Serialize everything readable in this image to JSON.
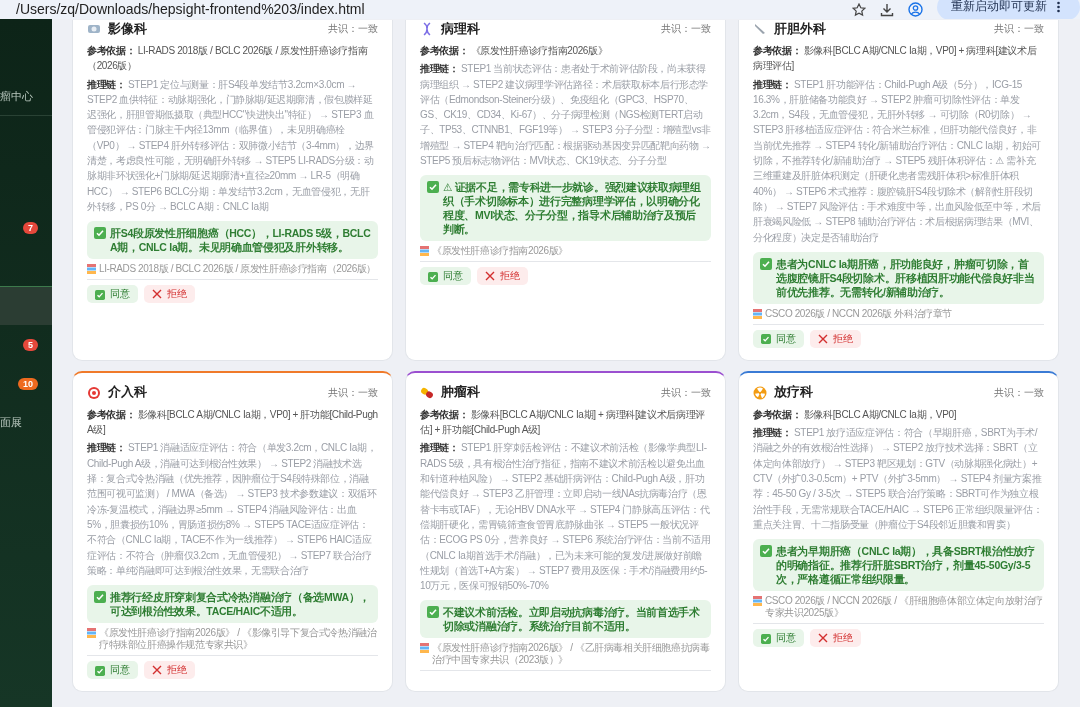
{
  "browser": {
    "url": "/Users/zq/Downloads/hepsight-frontend%203/index.html",
    "update_button": "重新启动即可更新"
  },
  "sidebar": {
    "items": [
      {
        "label": "瘤中心",
        "selected": false
      },
      {
        "badge": "7",
        "color": "#e5483b",
        "selected": false
      },
      {
        "selected": true
      },
      {
        "badge": "5",
        "color": "#e5483b",
        "selected": false
      },
      {
        "badge": "10",
        "color": "#ee6a1f",
        "selected": false
      },
      {
        "label": "面展",
        "selected": false
      }
    ]
  },
  "cards": [
    {
      "kind": "imaging",
      "department": "影像科",
      "consensus": "共识：一致",
      "basis_label": "参考依据：",
      "basis": "LI-RADS 2018版 / BCLC 2026版 / 原发性肝癌诊疗指南（2026版）",
      "chain_label": "推理链：",
      "chain": "STEP1 定位与测量：肝S4段单发结节3.2cm×3.0cm → STEP2 血供特征：动脉期强化，门静脉期/延迟期廓清，假包膜样延迟强化，肝胆管期低摄取（典型HCC\"快进快出\"特征） → STEP3 血管侵犯评估：门脉主干内径13mm（临界值），未见明确癌栓（VP0） → STEP4 肝外转移评估：双肺微小结节（3-4mm），边界清楚，考虑良性可能，无明确肝外转移 → STEP5 LI-RADS分级：动脉期非环状强化+门脉期/延迟期廓清+直径≥20mm → LR-5（明确HCC） → STEP6 BCLC分期：单发结节3.2cm，无血管侵犯，无肝外转移，PS 0分 → BCLC A期：CNLC Ia期",
      "conclusion": "肝S4段原发性肝细胞癌（HCC），LI-RADS 5级，BCLC A期，CNLC Ia期。未见明确血管侵犯及肝外转移。",
      "source": "LI-RADS 2018版 / BCLC 2026版 / 原发性肝癌诊疗指南（2026版）",
      "buttons": [
        {
          "kind": "agree",
          "label": "同意"
        },
        {
          "kind": "reject",
          "label": "拒绝"
        }
      ]
    },
    {
      "kind": "pathology",
      "department": "病理科",
      "consensus": "共识：一致",
      "basis_label": "参考依据：",
      "basis": "《原发性肝癌诊疗指南2026版》",
      "chain_label": "推理链：",
      "chain": "STEP1 当前状态评估：患者处于术前评估阶段，尚未获得病理组织 → STEP2 建议病理学评估路径：术后获取标本后行形态学评估（Edmondson-Steiner分级）、免疫组化（GPC3、HSP70、GS、CK19、CD34、Ki-67）、分子病理检测（NGS检测TERT启动子、TP53、CTNNB1、FGF19等） → STEP3 分子分型：增殖型vs非增殖型 → STEP4 靶向治疗匹配：根据驱动基因变异匹配靶向药物 → STEP5 预后标志物评估：MVI状态、CK19状态、分子分型",
      "conclusion": "⚠ 证据不足，需专科进一步就诊。强烈建议获取病理组织（手术切除标本）进行完整病理学评估，以明确分化程度、MVI状态、分子分型，指导术后辅助治疗及预后判断。",
      "source": "《原发性肝癌诊疗指南2026版》",
      "buttons": [
        {
          "kind": "agree",
          "label": "同意"
        },
        {
          "kind": "reject",
          "label": "拒绝"
        }
      ]
    },
    {
      "kind": "surgery",
      "department": "肝胆外科",
      "consensus": "共识：一致",
      "basis_label": "参考依据：",
      "basis": "影像科[BCLC A期/CNLC Ia期，VP0] + 病理科[建议术后病理评估]",
      "chain_label": "推理链：",
      "chain": "STEP1 肝功能评估：Child-Pugh A级（5分），ICG-15 16.3%，肝脏储备功能良好 → STEP2 肿瘤可切除性评估：单发3.2cm，S4段，无血管侵犯，无肝外转移 → 可切除（R0切除） → STEP3 肝移植适应症评估：符合米兰标准，但肝功能代偿良好，非当前优先推荐 → STEP4 转化/新辅助治疗评估：CNLC Ia期，初始可切除，不推荐转化/新辅助治疗 → STEP5 残肝体积评估：⚠ 需补充三维重建及肝脏体积测定（肝硬化患者需残肝体积>标准肝体积40%） → STEP6 术式推荐：腹腔镜肝S4段切除术（解剖性肝段切除） → STEP7 风险评估：手术难度中等，出血风险低至中等，术后肝衰竭风险低 → STEP8 辅助治疗评估：术后根据病理结果（MVI、分化程度）决定是否辅助治疗",
      "conclusion": "患者为CNLC Ia期肝癌，肝功能良好，肿瘤可切除，首选腹腔镜肝S4段切除术。肝移植因肝功能代偿良好非当前优先推荐。无需转化/新辅助治疗。",
      "source": "CSCO 2026版 / NCCN 2026版 外科治疗章节",
      "buttons": [
        {
          "kind": "agree",
          "label": "同意"
        },
        {
          "kind": "reject",
          "label": "拒绝"
        }
      ]
    },
    {
      "kind": "interventional",
      "color": "#f07a2a",
      "department": "介入科",
      "consensus": "共识：一致",
      "basis_label": "参考依据：",
      "basis": "影像科[BCLC A期/CNLC Ia期，VP0] + 肝功能[Child-Pugh A级]",
      "chain_label": "推理链：",
      "chain": "STEP1 消融适应症评估：符合（单发3.2cm，CNLC Ia期，Child-Pugh A级，消融可达到根治性效果） → STEP2 消融技术选择：复合式冷热消融（优先推荐，因肿瘤位于S4段特殊部位，消融范围可视可监测） / MWA（备选） → STEP3 技术参数建议：双循环冷冻-复温模式，消融边界≥5mm → STEP4 消融风险评估：出血5%，胆囊损伤10%，胃肠道损伤8% → STEP5 TACE适应症评估：不符合（CNLC Ia期，TACE不作为一线推荐） → STEP6 HAIC适应症评估：不符合（肿瘤仅3.2cm，无血管侵犯） → STEP7 联合治疗策略：单纯消融即可达到根治性效果，无需联合治疗",
      "conclusion": "推荐行经皮肝穿刺复合式冷热消融治疗（备选MWA），可达到根治性效果。TACE/HAIC不适用。",
      "source": "《原发性肝癌诊疗指南2026版》 / 《影像引导下复合式冷热消融治疗特殊部位肝癌操作规范专家共识》",
      "buttons": [
        {
          "kind": "agree",
          "label": "同意"
        },
        {
          "kind": "reject",
          "label": "拒绝"
        }
      ]
    },
    {
      "kind": "oncology",
      "color": "#9b4fd0",
      "department": "肿瘤科",
      "consensus": "共识：一致",
      "basis_label": "参考依据：",
      "basis": "影像科[BCLC A期/CNLC Ia期] + 病理科[建议术后病理评估] + 肝功能[Child-Pugh A级]",
      "chain_label": "推理链：",
      "chain": "STEP1 肝穿刺活检评估：不建议术前活检（影像学典型LI-RADS 5级，具有根治性治疗指征，指南不建议术前活检以避免出血和针道种植风险） → STEP2 基础肝病评估：Child-Pugh A级，肝功能代偿良好 → STEP3 乙肝管理：立即启动一线NAs抗病毒治疗（恩替卡韦或TAF），无论HBV DNA水平 → STEP4 门静脉高压评估：代偿期肝硬化，需胃镜筛查食管胃底静脉曲张 → STEP5 一般状况评估：ECOG PS 0分，营养良好 → STEP6 系统治疗评估：当前不适用（CNLC Ia期首选手术/消融），已为未来可能的复发/进展做好前瞻性规划（首选T+A方案） → STEP7 费用及医保：手术/消融费用约5-10万元，医保可报销50%-70%",
      "conclusion": "不建议术前活检。立即启动抗病毒治疗。当前首选手术切除或消融治疗。系统治疗目前不适用。",
      "source": "《原发性肝癌诊疗指南2026版》 / 《乙肝病毒相关肝细胞癌抗病毒治疗中国专家共识（2023版）》"
    },
    {
      "kind": "radiotherapy",
      "color": "#3a7bd5",
      "department": "放疗科",
      "consensus": "共识：一致",
      "basis_label": "参考依据：",
      "basis": "影像科[BCLC A期/CNLC Ia期，VP0]",
      "chain_label": "推理链：",
      "chain": "STEP1 放疗适应症评估：符合（早期肝癌，SBRT为手术/消融之外的有效根治性选择） → STEP2 放疗技术选择：SBRT（立体定向体部放疗） → STEP3 靶区规划：GTV（动脉期强化病灶）+ CTV（外扩0.3-0.5cm）+ PTV（外扩3-5mm） → STEP4 剂量方案推荐：45-50 Gy / 3-5次 → STEP5 联合治疗策略：SBRT可作为独立根治性手段，无需常规联合TACE/HAIC → STEP6 正常组织限量评估：重点关注胃、十二指肠受量（肿瘤位于S4段邻近胆囊和胃窦）",
      "conclusion": "患者为早期肝癌（CNLC Ia期），具备SBRT根治性放疗的明确指征。推荐行肝脏SBRT治疗，剂量45-50Gy/3-5次，严格遵循正常组织限量。",
      "source": "CSCO 2026版 / NCCN 2026版 / 《肝细胞癌体部立体定向放射治疗专家共识2025版》",
      "buttons": [
        {
          "kind": "agree",
          "label": "同意"
        },
        {
          "kind": "reject",
          "label": "拒绝"
        }
      ]
    }
  ]
}
